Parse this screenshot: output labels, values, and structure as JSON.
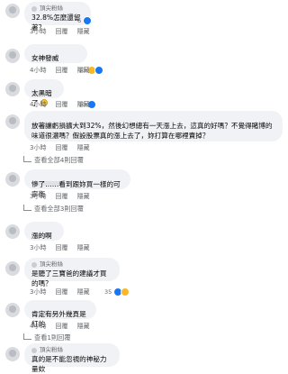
{
  "comments": [
    {
      "badge": "頂尖粉絲",
      "text": "32.8%怎麼還留著？",
      "time": "3小時",
      "reply_label": "回覆",
      "hide_label": "隱藏",
      "reaction_count": "6"
    },
    {
      "text": "女神發威",
      "time": "4小時",
      "reply_label": "回覆",
      "hide_label": "隱藏",
      "reaction_count": "13"
    },
    {
      "text": "太黑暗了",
      "time": "4小時",
      "reply_label": "回覆",
      "hide_label": "隱藏",
      "reaction_count": "10"
    },
    {
      "text": "放著讓虧損擴大到32%，然後幻想總有一天漲上去，這真的好嗎？不覺得賭博的味道很濃嗎？假設股票真的漲上去了，妳打算在哪裡賣掉？",
      "time": "3小時",
      "reply_label": "回覆",
      "hide_label": "隱藏",
      "view_more": "查看全部4則回覆"
    },
    {
      "text": "慘了……看到跟妳買一樣的可寧衛",
      "time": "3小時",
      "reply_label": "回覆",
      "hide_label": "隱藏",
      "view_more": "查看全部3則回覆"
    },
    {
      "text": "漲的啊",
      "time": "3小時",
      "reply_label": "回覆",
      "hide_label": "隱藏"
    },
    {
      "badge": "頂尖粉絲",
      "text": "是聽了三寶爸的建議才買的嗎？",
      "time": "3小時",
      "reply_label": "回覆",
      "hide_label": "隱藏",
      "reaction_count": "35"
    },
    {
      "text": "肯定有另外幾頁是紅的",
      "time": "4小時",
      "reply_label": "回覆",
      "hide_label": "隱藏",
      "view_more": "查看1則回覆"
    },
    {
      "badge": "頂尖粉絲",
      "text": "真的是不能忽視的神秘力量欸"
    }
  ]
}
